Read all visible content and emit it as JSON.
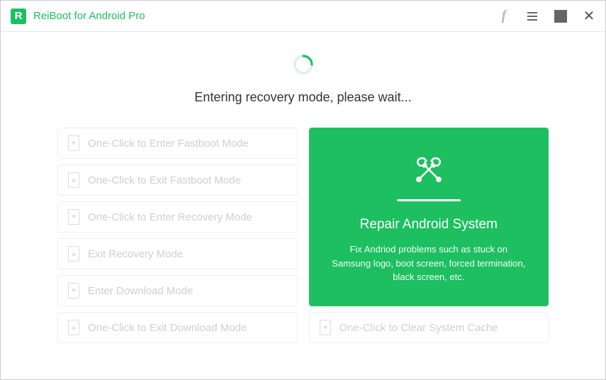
{
  "titlebar": {
    "title": "ReiBoot for Android Pro"
  },
  "status": {
    "message": "Entering recovery mode, please wait..."
  },
  "left_buttons": [
    {
      "label": "One-Click to Enter Fastboot Mode",
      "icon": "arrow-down"
    },
    {
      "label": "One-Click to Exit Fastboot Mode",
      "icon": "arrow-up"
    },
    {
      "label": "One-Click to Enter Recovery Mode",
      "icon": "arrow-down"
    },
    {
      "label": "Exit Recovery Mode",
      "icon": "arrow-up"
    },
    {
      "label": "Enter Download Mode",
      "icon": "arrow-down"
    },
    {
      "label": "One-Click to Exit Download Mode",
      "icon": "arrow-up"
    }
  ],
  "repair": {
    "title": "Repair Android System",
    "description": "Fix Andriod problems such as stuck on Samsung logo, boot screen, forced termination, black screen, etc."
  },
  "cache_button": {
    "label": "One-Click to Clear System Cache"
  },
  "colors": {
    "accent": "#1dbf60"
  }
}
